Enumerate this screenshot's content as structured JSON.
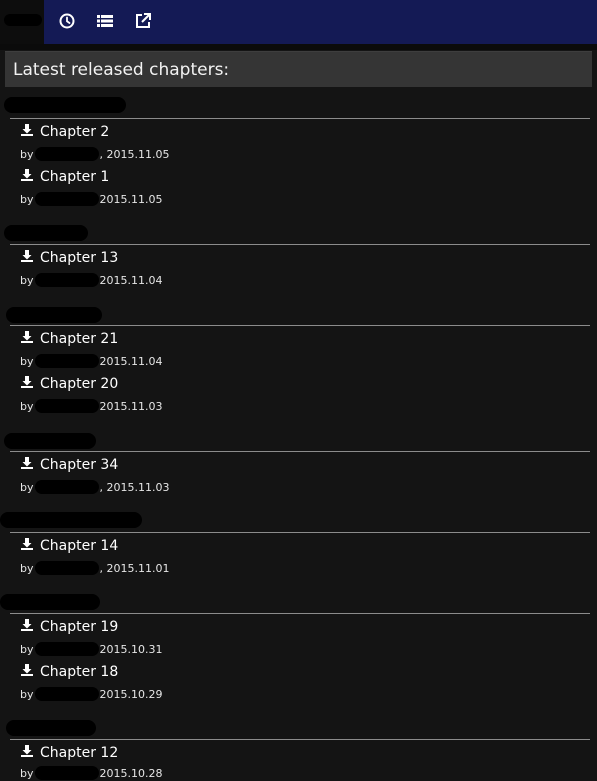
{
  "nav": {
    "icons": [
      "history-icon",
      "list-icon",
      "external-link-icon"
    ]
  },
  "header": {
    "title": "Latest released chapters:"
  },
  "byline_prefix": "by",
  "groups": [
    {
      "chapters": [
        {
          "label": "Chapter 2",
          "date": ", 2015.11.05"
        },
        {
          "label": "Chapter 1",
          "date": "2015.11.05"
        }
      ]
    },
    {
      "chapters": [
        {
          "label": "Chapter 13",
          "date": "2015.11.04"
        }
      ]
    },
    {
      "chapters": [
        {
          "label": "Chapter 21",
          "date": "2015.11.04"
        },
        {
          "label": "Chapter 20",
          "date": "2015.11.03"
        }
      ]
    },
    {
      "chapters": [
        {
          "label": "Chapter 34",
          "date": ", 2015.11.03"
        }
      ]
    },
    {
      "chapters": [
        {
          "label": "Chapter 14",
          "date": ", 2015.11.01"
        }
      ]
    },
    {
      "chapters": [
        {
          "label": "Chapter 19",
          "date": "2015.10.31"
        },
        {
          "label": "Chapter 18",
          "date": "2015.10.29"
        }
      ]
    },
    {
      "chapters": [
        {
          "label": "Chapter 12",
          "date": "2015.10.28"
        }
      ]
    }
  ]
}
